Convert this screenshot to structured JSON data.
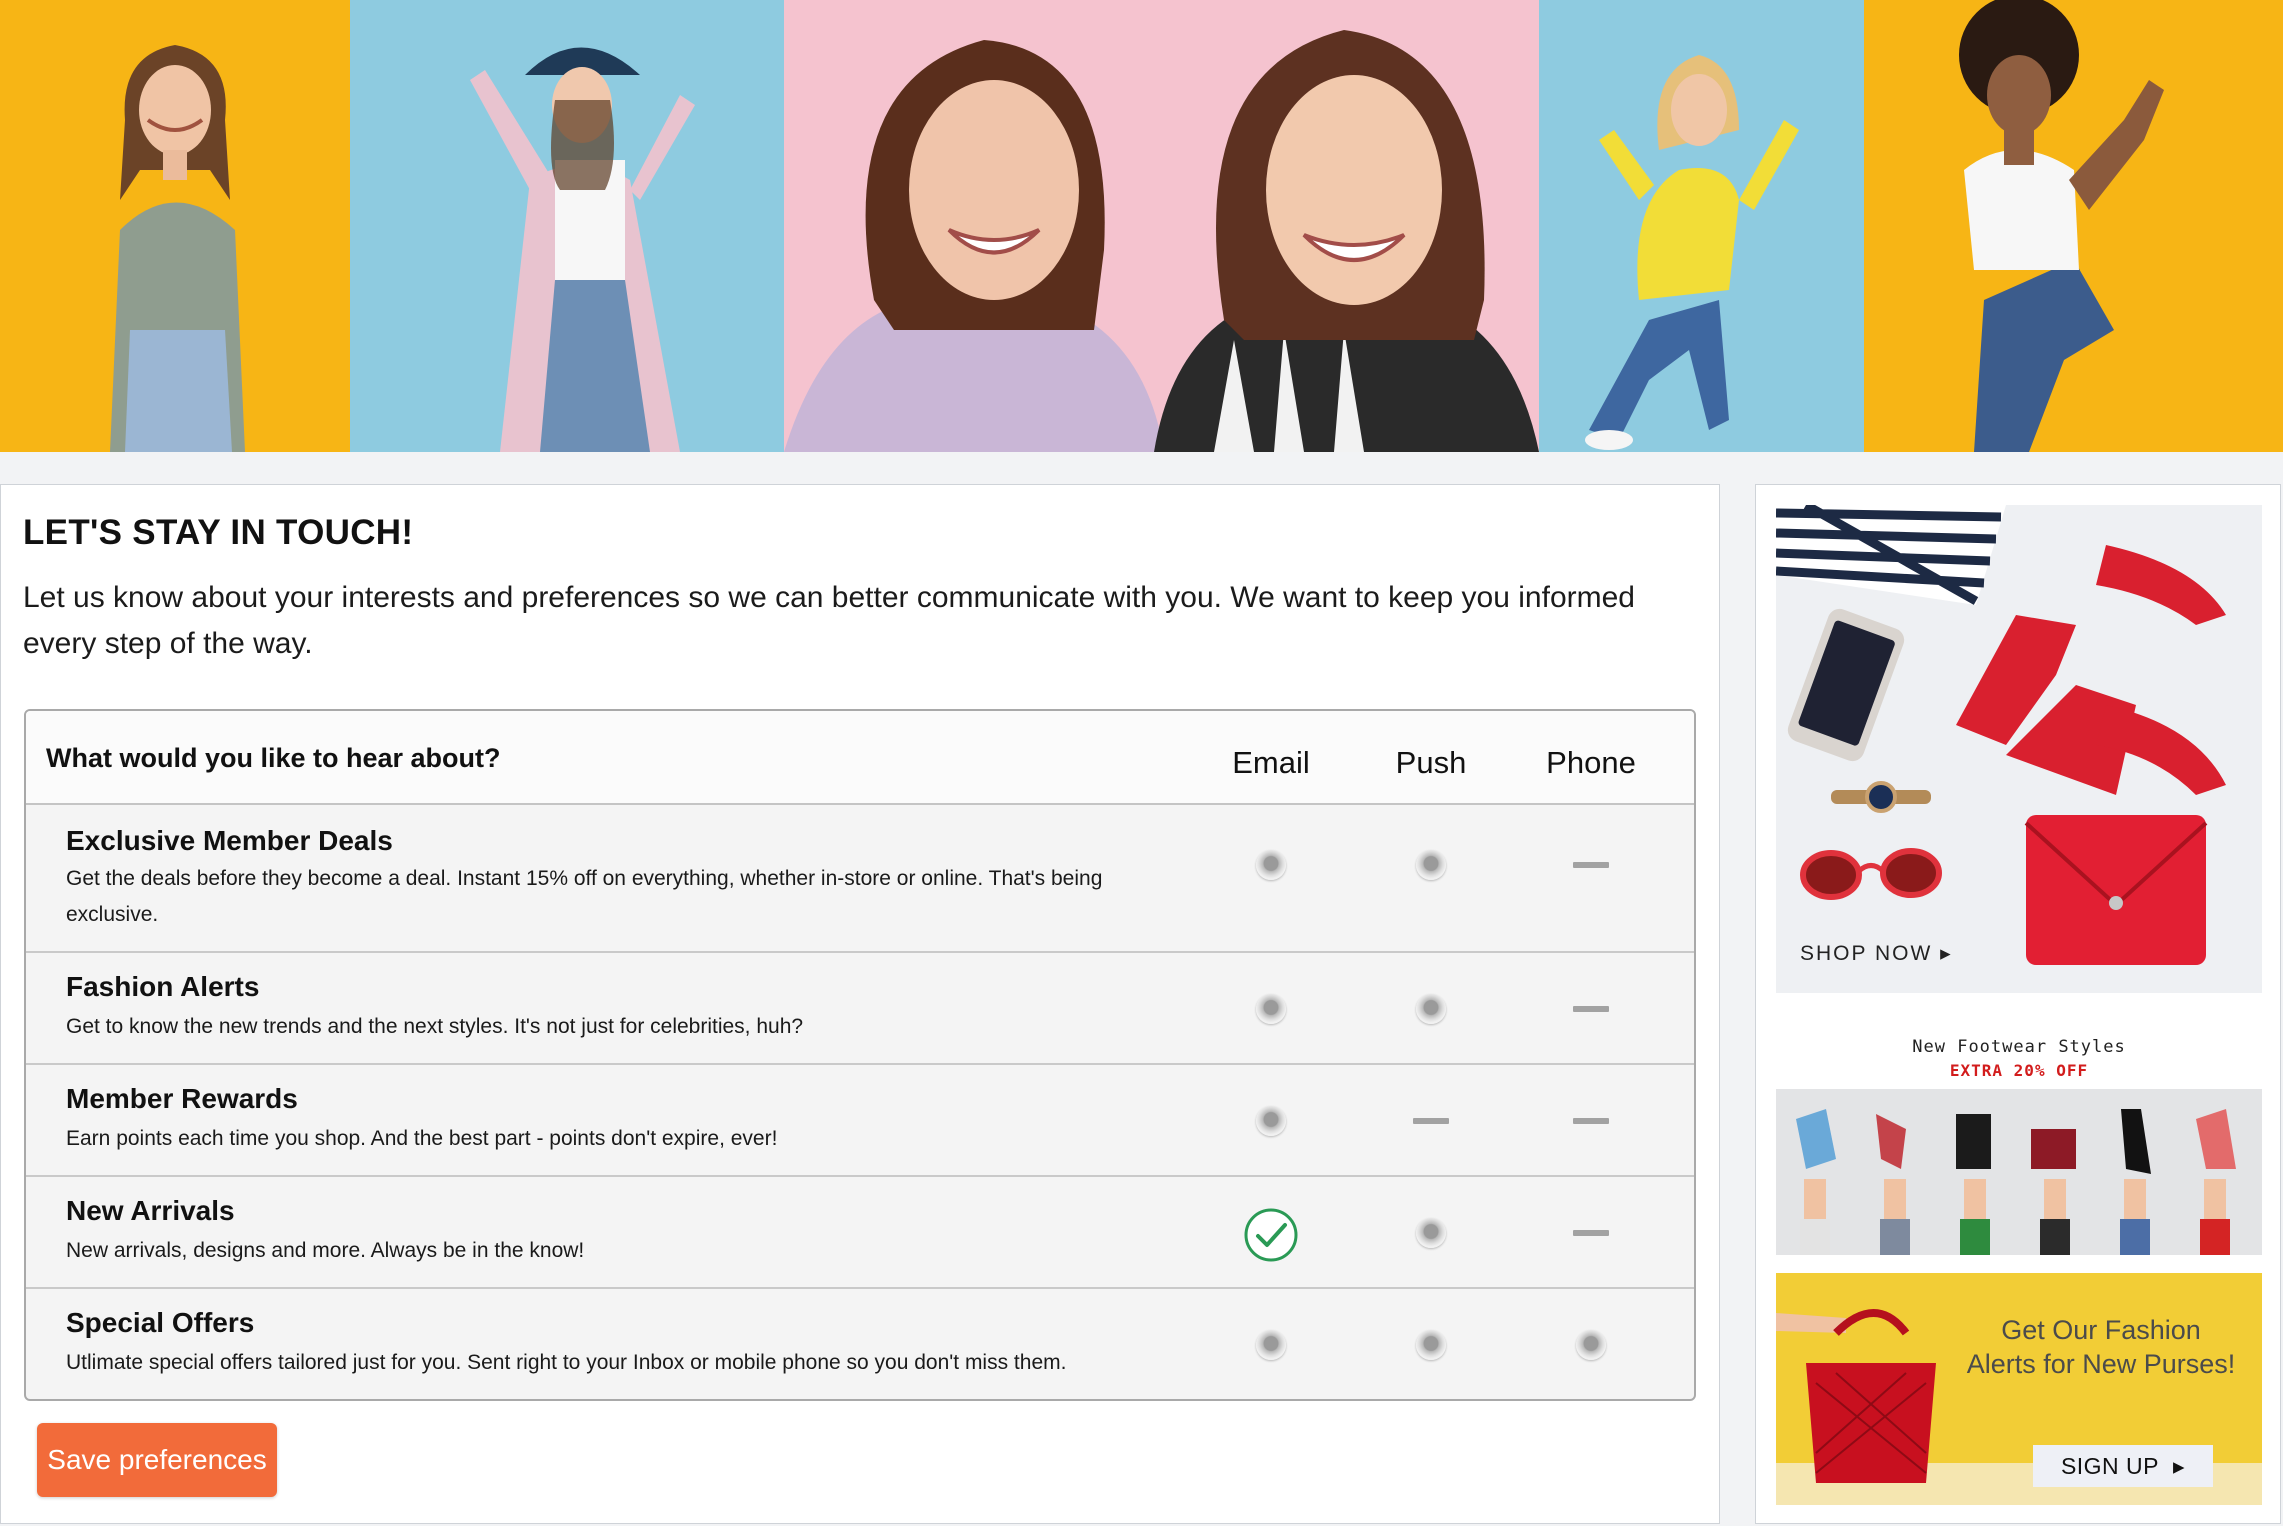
{
  "header": {
    "banner_image": "hero-collage"
  },
  "preferences": {
    "title": "LET'S STAY IN TOUCH!",
    "intro": "Let us know about your interests and preferences so we can better communicate with you. We want to keep you informed every step of the way.",
    "question": "What would you like to hear about?",
    "channels": [
      "Email",
      "Push",
      "Phone"
    ],
    "topics": [
      {
        "title": "Exclusive Member Deals",
        "desc": "Get the deals before they become a deal. Instant 15% off on everything, whether in-store or online. That's being exclusive.",
        "email": "radio",
        "push": "radio",
        "phone": "unavailable"
      },
      {
        "title": "Fashion Alerts",
        "desc": "Get to know the new trends and the next styles. It's not just for celebrities, huh?",
        "email": "radio",
        "push": "radio",
        "phone": "unavailable"
      },
      {
        "title": "Member Rewards",
        "desc": "Earn points each time you shop. And the best part - points don't expire, ever!",
        "email": "radio",
        "push": "unavailable",
        "phone": "unavailable"
      },
      {
        "title": "New Arrivals",
        "desc": "New arrivals, designs and more. Always be in the know!",
        "email": "checked",
        "push": "radio",
        "phone": "unavailable"
      },
      {
        "title": "Special Offers",
        "desc": "Utlimate special offers tailored just for you. Sent right to your Inbox or mobile phone so you don't miss them.",
        "email": "radio",
        "push": "radio",
        "phone": "radio"
      }
    ],
    "save_label": "Save preferences",
    "accent_color": "#f26b3a"
  },
  "sidebar": {
    "ad1": {
      "cta": "SHOP NOW"
    },
    "ad2": {
      "title": "New Footwear Styles",
      "subtitle": "EXTRA 20% OFF"
    },
    "ad3": {
      "text": "Get Our Fashion Alerts for New Purses!",
      "cta": "SIGN UP"
    }
  }
}
